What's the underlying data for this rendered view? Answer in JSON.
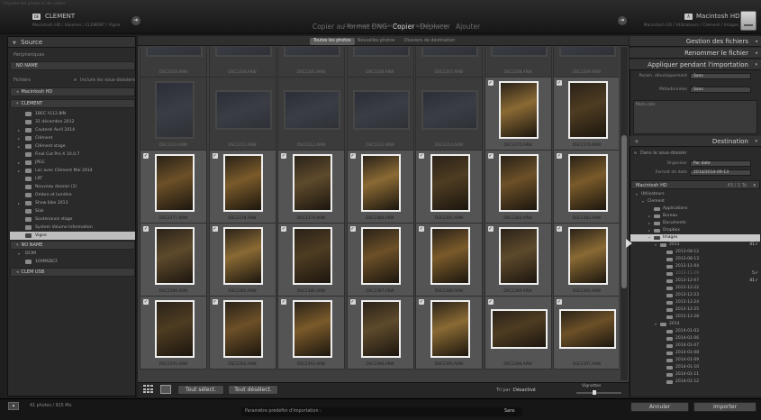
{
  "window": {
    "caption": "Importer des photos et des vidéos"
  },
  "source_header": {
    "badge": "DE",
    "name": "CLEMENT",
    "path": "Macintosh HD / Volumes / CLEMENT / Vigne"
  },
  "import_modes": {
    "items": [
      {
        "label": "Copier au format DNG",
        "active": false
      },
      {
        "label": "Copier",
        "active": true
      },
      {
        "label": "Déplacer",
        "active": false
      },
      {
        "label": "Ajouter",
        "active": false
      }
    ],
    "subtitle": "Copie photos en nouvel emplac. et ajouter au catal."
  },
  "dest_header": {
    "badge": "À",
    "name": "Macintosh HD",
    "path": "Macintosh HD / Utilisateurs / Clement / Images"
  },
  "source_panel": {
    "title": "Source",
    "peripheriques_label": "Périphériques",
    "device_noname": "NO NAME",
    "fichiers_label": "Fichiers",
    "include_subfolders": "Inclure les sous-dossiers",
    "disks": [
      "Macintosh HD",
      "CLEMENT"
    ],
    "folders": [
      {
        "label": "1BEC YL12.8IN",
        "has_tri": false,
        "selected": false
      },
      {
        "label": "31 décembre 2012",
        "has_tri": false,
        "selected": false
      },
      {
        "label": "Cauterel Avril 2014",
        "has_tri": true,
        "selected": false
      },
      {
        "label": "Clément",
        "has_tri": true,
        "selected": false
      },
      {
        "label": "Clément stage",
        "has_tri": true,
        "selected": false
      },
      {
        "label": "Final Cut Pro X 10.0.7",
        "has_tri": false,
        "selected": false
      },
      {
        "label": "JPEG",
        "has_tri": true,
        "selected": false
      },
      {
        "label": "Lac avec Clément Mai 2014",
        "has_tri": true,
        "selected": false
      },
      {
        "label": "LRT",
        "has_tri": false,
        "selected": false
      },
      {
        "label": "Nouveau dossier (2)",
        "has_tri": false,
        "selected": false
      },
      {
        "label": "Ombre et lumière",
        "has_tri": false,
        "selected": false
      },
      {
        "label": "Show bike 2013",
        "has_tri": true,
        "selected": false
      },
      {
        "label": "Slak",
        "has_tri": false,
        "selected": false
      },
      {
        "label": "Soutenance stage",
        "has_tri": false,
        "selected": false
      },
      {
        "label": "System Volume Information",
        "has_tri": false,
        "selected": false
      },
      {
        "label": "Vigne",
        "has_tri": false,
        "selected": true
      }
    ],
    "bottom_devices": [
      "NO NAME",
      "DCIM",
      "100MSDCF",
      "CLEM USB"
    ]
  },
  "tabs": [
    "Toutes les photos",
    "Nouvelles photos",
    "Dossiers de destination"
  ],
  "thumbnails": {
    "rows": [
      [
        {
          "name": "DSC2203.ARW",
          "checked": false,
          "portrait": false
        },
        {
          "name": "DSC2204.ARW",
          "checked": false,
          "portrait": false
        },
        {
          "name": "DSC2205.ARW",
          "checked": false,
          "portrait": false
        },
        {
          "name": "DSC2206.ARW",
          "checked": false,
          "portrait": false
        },
        {
          "name": "DSC2207.ARW",
          "checked": false,
          "portrait": false
        },
        {
          "name": "DSC2208.ARW",
          "checked": false,
          "portrait": false
        },
        {
          "name": "DSC2209.ARW",
          "checked": false,
          "portrait": false
        }
      ],
      [
        {
          "name": "DSC2210.ARW",
          "checked": false,
          "portrait": true
        },
        {
          "name": "DSC2211.ARW",
          "checked": false,
          "portrait": false
        },
        {
          "name": "DSC2212.ARW",
          "checked": false,
          "portrait": false
        },
        {
          "name": "DSC2213.ARW",
          "checked": false,
          "portrait": false
        },
        {
          "name": "DSC2214.ARW",
          "checked": false,
          "portrait": false
        },
        {
          "name": "DSC2375.ARW",
          "checked": true,
          "portrait": true
        },
        {
          "name": "DSC2376.ARW",
          "checked": true,
          "portrait": true
        }
      ],
      [
        {
          "name": "DSC2377.ARW",
          "checked": true,
          "portrait": true
        },
        {
          "name": "DSC2378.ARW",
          "checked": true,
          "portrait": true
        },
        {
          "name": "DSC2379.ARW",
          "checked": true,
          "portrait": true
        },
        {
          "name": "DSC2380.ARW",
          "checked": true,
          "portrait": true
        },
        {
          "name": "DSC2381.ARW",
          "checked": true,
          "portrait": true
        },
        {
          "name": "DSC2382.ARW",
          "checked": true,
          "portrait": true
        },
        {
          "name": "DSC2383.ARW",
          "checked": true,
          "portrait": true
        }
      ],
      [
        {
          "name": "DSC2384.ARW",
          "checked": true,
          "portrait": true
        },
        {
          "name": "DSC2385.ARW",
          "checked": true,
          "portrait": true
        },
        {
          "name": "DSC2386.ARW",
          "checked": true,
          "portrait": true
        },
        {
          "name": "DSC2387.ARW",
          "checked": true,
          "portrait": true
        },
        {
          "name": "DSC2388.ARW",
          "checked": true,
          "portrait": true
        },
        {
          "name": "DSC2389.ARW",
          "checked": true,
          "portrait": true
        },
        {
          "name": "DSC2390.ARW",
          "checked": true,
          "portrait": true
        }
      ],
      [
        {
          "name": "DSC2391.ARW",
          "checked": true,
          "portrait": true
        },
        {
          "name": "DSC2392.ARW",
          "checked": true,
          "portrait": true
        },
        {
          "name": "DSC2393.ARW",
          "checked": true,
          "portrait": true
        },
        {
          "name": "DSC2394.ARW",
          "checked": true,
          "portrait": true
        },
        {
          "name": "DSC2395.ARW",
          "checked": true,
          "portrait": true
        },
        {
          "name": "DSC2396.ARW",
          "checked": true,
          "portrait": false
        },
        {
          "name": "DSC2397.ARW",
          "checked": true,
          "portrait": false
        }
      ]
    ]
  },
  "toolbar": {
    "select_all": "Tout sélect.",
    "deselect_all": "Tout désélect.",
    "sort_label": "Tri par :",
    "sort_value": "Désactivé",
    "thumbnails_label": "Vignettes",
    "thumbnail_size": 0.4
  },
  "right_panel": {
    "file_handling": "Gestion des fichiers",
    "rename": "Renommer le fichier",
    "apply_during_import": "Appliquer pendant l'importation",
    "dev_settings_label": "Param. développement",
    "dev_settings_value": "Sans",
    "metadata_label": "Métadonnées",
    "metadata_value": "Sans",
    "keywords_label": "Mots clés",
    "destination": "Destination",
    "subfolder_option": "Dans le sous-dossier",
    "organize_label": "Organiser",
    "organize_value": "Par date",
    "date_format_label": "Format de date",
    "date_format_value": "2014/2014-09-13",
    "volume_name": "Macintosh HD",
    "volume_space": "43 / 1 To"
  },
  "dest_tree": [
    {
      "label": "Utilisateurs",
      "level": 0,
      "tri": "▾",
      "count": "",
      "check": "",
      "selected": false,
      "dim": false
    },
    {
      "label": "Clement",
      "level": 1,
      "tri": "▾",
      "count": "",
      "check": "",
      "selected": false,
      "dim": false
    },
    {
      "label": "Applications",
      "level": 2,
      "tri": "",
      "count": "",
      "check": "",
      "selected": false,
      "dim": false
    },
    {
      "label": "Bureau",
      "level": 2,
      "tri": "▸",
      "count": "",
      "check": "",
      "selected": false,
      "dim": false
    },
    {
      "label": "Documents",
      "level": 2,
      "tri": "▸",
      "count": "",
      "check": "",
      "selected": false,
      "dim": false
    },
    {
      "label": "Dropbox",
      "level": 2,
      "tri": "▸",
      "count": "",
      "check": "",
      "selected": false,
      "dim": false
    },
    {
      "label": "Images",
      "level": 2,
      "tri": "▾",
      "count": "",
      "check": "",
      "selected": true,
      "dim": false
    },
    {
      "label": "2013",
      "level": 3,
      "tri": "▾",
      "count": "41",
      "check": "✓",
      "selected": false,
      "dim": false
    },
    {
      "label": "2013-08-12",
      "level": 4,
      "tri": "",
      "count": "",
      "check": "",
      "selected": false,
      "dim": false
    },
    {
      "label": "2013-08-13",
      "level": 4,
      "tri": "",
      "count": "",
      "check": "",
      "selected": false,
      "dim": false
    },
    {
      "label": "2013-11-04",
      "level": 4,
      "tri": "",
      "count": "",
      "check": "",
      "selected": false,
      "dim": false
    },
    {
      "label": "2013-11-29",
      "level": 4,
      "tri": "",
      "count": "5",
      "check": "✓",
      "selected": false,
      "dim": true
    },
    {
      "label": "2013-12-07",
      "level": 4,
      "tri": "",
      "count": "41",
      "check": "✓",
      "selected": false,
      "dim": false
    },
    {
      "label": "2013-12-22",
      "level": 4,
      "tri": "",
      "count": "",
      "check": "",
      "selected": false,
      "dim": false
    },
    {
      "label": "2013-12-23",
      "level": 4,
      "tri": "",
      "count": "",
      "check": "",
      "selected": false,
      "dim": false
    },
    {
      "label": "2013-12-24",
      "level": 4,
      "tri": "",
      "count": "",
      "check": "",
      "selected": false,
      "dim": false
    },
    {
      "label": "2013-12-25",
      "level": 4,
      "tri": "",
      "count": "",
      "check": "",
      "selected": false,
      "dim": false
    },
    {
      "label": "2013-12-28",
      "level": 4,
      "tri": "",
      "count": "",
      "check": "",
      "selected": false,
      "dim": false
    },
    {
      "label": "2014",
      "level": 3,
      "tri": "▾",
      "count": "",
      "check": "",
      "selected": false,
      "dim": false
    },
    {
      "label": "2014-01-03",
      "level": 4,
      "tri": "",
      "count": "",
      "check": "",
      "selected": false,
      "dim": false
    },
    {
      "label": "2014-01-06",
      "level": 4,
      "tri": "",
      "count": "",
      "check": "",
      "selected": false,
      "dim": false
    },
    {
      "label": "2014-01-07",
      "level": 4,
      "tri": "",
      "count": "",
      "check": "",
      "selected": false,
      "dim": false
    },
    {
      "label": "2014-01-08",
      "level": 4,
      "tri": "",
      "count": "",
      "check": "",
      "selected": false,
      "dim": false
    },
    {
      "label": "2014-01-09",
      "level": 4,
      "tri": "",
      "count": "",
      "check": "",
      "selected": false,
      "dim": false
    },
    {
      "label": "2014-01-10",
      "level": 4,
      "tri": "",
      "count": "",
      "check": "",
      "selected": false,
      "dim": false
    },
    {
      "label": "2014-01-11",
      "level": 4,
      "tri": "",
      "count": "",
      "check": "",
      "selected": false,
      "dim": false
    },
    {
      "label": "2014-01-12",
      "level": 4,
      "tri": "",
      "count": "",
      "check": "",
      "selected": false,
      "dim": false
    }
  ],
  "footer": {
    "status": "41 photos / 915 Mo",
    "preset_label": "Paramètre prédéfini d'importation :",
    "preset_value": "Sans",
    "cancel": "Annuler",
    "import": "Importer"
  }
}
